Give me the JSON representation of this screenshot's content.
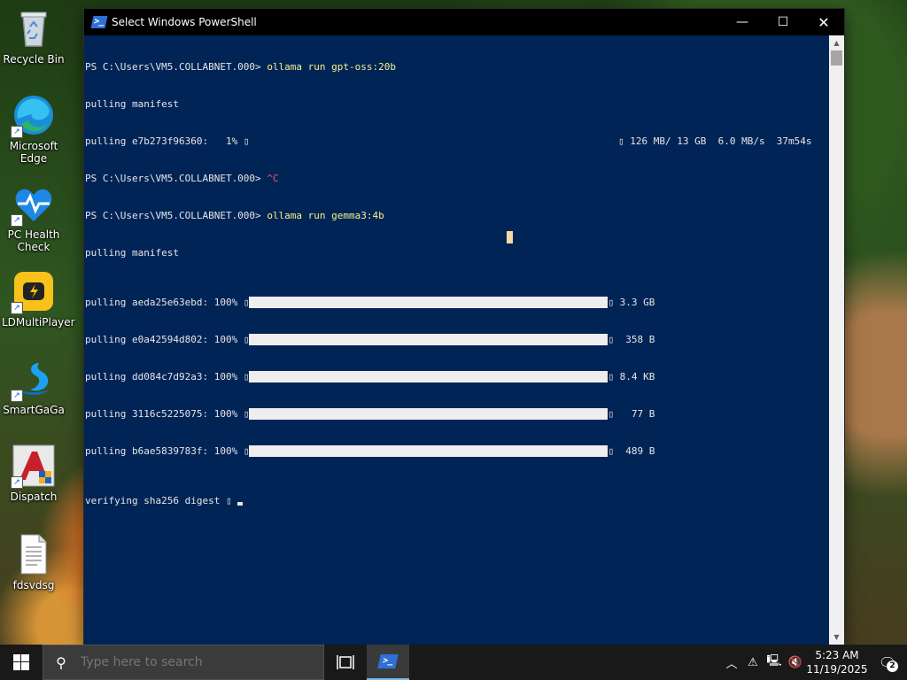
{
  "desktop": {
    "icons": [
      {
        "label": "Recycle Bin",
        "icon": "recycle-bin-icon"
      },
      {
        "label": "Microsoft\nEdge",
        "icon": "edge-icon"
      },
      {
        "label": "PC Health\nCheck",
        "icon": "pc-health-check-icon"
      },
      {
        "label": "LDMultiPlayer",
        "icon": "ldmultiplayer-icon"
      },
      {
        "label": "SmartGaGa",
        "icon": "smartgaga-icon"
      },
      {
        "label": "Dispatch",
        "icon": "dispatch-icon"
      },
      {
        "label": "fdsvdsg",
        "icon": "text-file-icon"
      }
    ]
  },
  "window": {
    "title": "Select Windows PowerShell",
    "controls": {
      "minimize": "—",
      "maximize": "☐",
      "close": "✕"
    }
  },
  "console": {
    "prompt": "PS C:\\Users\\VM5.COLLABNET.000> ",
    "cmd1": "ollama run gpt-oss:20b",
    "l2": "pulling manifest",
    "l3_left": "pulling e7b273f96360:   1% ▯",
    "l3_right": "▯ 126 MB/ 13 GB  6.0 MB/s  37m54s",
    "ctrlc": "^C",
    "cmd2": "ollama run gemma3:4b",
    "l6": "pulling manifest",
    "pulls": [
      {
        "prefix": "pulling aeda25e63ebd: 100% ▯",
        "size": "▯ 3.3 GB"
      },
      {
        "prefix": "pulling e0a42594d802: 100% ▯",
        "size": "▯  358 B"
      },
      {
        "prefix": "pulling dd084c7d92a3: 100% ▯",
        "size": "▯ 8.4 KB"
      },
      {
        "prefix": "pulling 3116c5225075: 100% ▯",
        "size": "▯   77 B"
      },
      {
        "prefix": "pulling b6ae5839783f: 100% ▯",
        "size": "▯  489 B"
      }
    ],
    "verify": "verifying sha256 digest ▯ "
  },
  "taskbar": {
    "search_placeholder": "Type here to search",
    "clock_time": "5:23 AM",
    "clock_date": "11/19/2025",
    "notification_count": "2"
  }
}
